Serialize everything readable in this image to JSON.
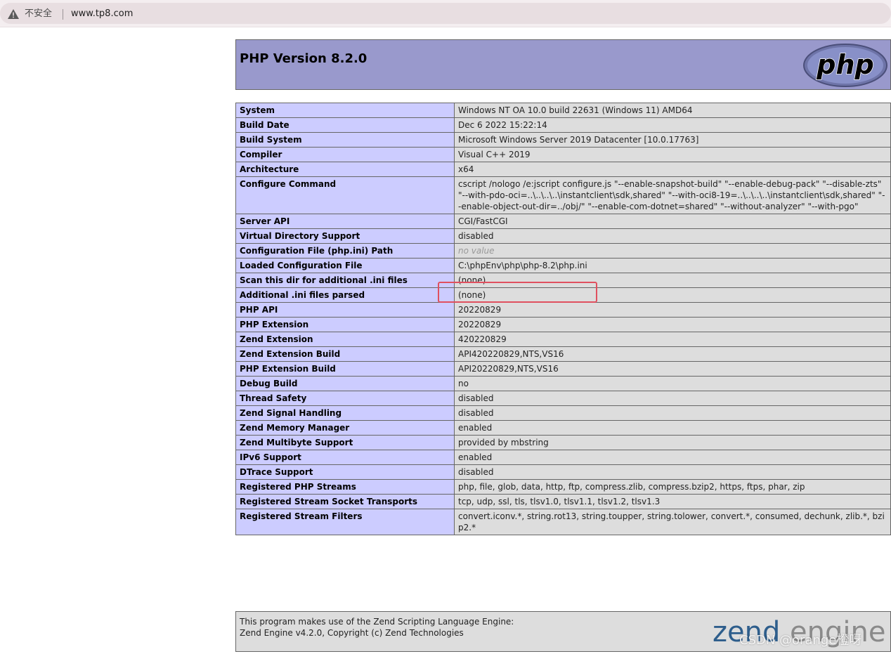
{
  "browser": {
    "security_label": "不安全",
    "url": "www.tp8.com"
  },
  "header": {
    "title": "PHP Version 8.2.0"
  },
  "rows": [
    {
      "key": "System",
      "value": "Windows NT OA 10.0 build 22631 (Windows 11) AMD64"
    },
    {
      "key": "Build Date",
      "value": "Dec 6 2022 15:22:14"
    },
    {
      "key": "Build System",
      "value": "Microsoft Windows Server 2019 Datacenter [10.0.17763]"
    },
    {
      "key": "Compiler",
      "value": "Visual C++ 2019"
    },
    {
      "key": "Architecture",
      "value": "x64"
    },
    {
      "key": "Configure Command",
      "value": "cscript /nologo /e:jscript configure.js \"--enable-snapshot-build\" \"--enable-debug-pack\" \"--disable-zts\" \"--with-pdo-oci=..\\..\\..\\..\\instantclient\\sdk,shared\" \"--with-oci8-19=..\\..\\..\\..\\instantclient\\sdk,shared\" \"--enable-object-out-dir=../obj/\" \"--enable-com-dotnet=shared\" \"--without-analyzer\" \"--with-pgo\""
    },
    {
      "key": "Server API",
      "value": "CGI/FastCGI"
    },
    {
      "key": "Virtual Directory Support",
      "value": "disabled"
    },
    {
      "key": "Configuration File (php.ini) Path",
      "value": "no value"
    },
    {
      "key": "Loaded Configuration File",
      "value": "C:\\phpEnv\\php\\php-8.2\\php.ini"
    },
    {
      "key": "Scan this dir for additional .ini files",
      "value": "(none)"
    },
    {
      "key": "Additional .ini files parsed",
      "value": "(none)"
    },
    {
      "key": "PHP API",
      "value": "20220829"
    },
    {
      "key": "PHP Extension",
      "value": "20220829"
    },
    {
      "key": "Zend Extension",
      "value": "420220829"
    },
    {
      "key": "Zend Extension Build",
      "value": "API420220829,NTS,VS16"
    },
    {
      "key": "PHP Extension Build",
      "value": "API20220829,NTS,VS16"
    },
    {
      "key": "Debug Build",
      "value": "no"
    },
    {
      "key": "Thread Safety",
      "value": "disabled"
    },
    {
      "key": "Zend Signal Handling",
      "value": "disabled"
    },
    {
      "key": "Zend Memory Manager",
      "value": "enabled"
    },
    {
      "key": "Zend Multibyte Support",
      "value": "provided by mbstring"
    },
    {
      "key": "IPv6 Support",
      "value": "enabled"
    },
    {
      "key": "DTrace Support",
      "value": "disabled"
    },
    {
      "key": "Registered PHP Streams",
      "value": "php, file, glob, data, http, ftp, compress.zlib, compress.bzip2, https, ftps, phar, zip"
    },
    {
      "key": "Registered Stream Socket Transports",
      "value": "tcp, udp, ssl, tls, tlsv1.0, tlsv1.1, tlsv1.2, tlsv1.3"
    },
    {
      "key": "Registered Stream Filters",
      "value": "convert.iconv.*, string.rot13, string.toupper, string.tolower, convert.*, consumed, dechunk, zlib.*, bzip2.*"
    }
  ],
  "footer": {
    "line1": "This program makes use of the Zend Scripting Language Engine:",
    "line2": "Zend Engine v4.2.0, Copyright (c) Zend Technologies",
    "logo_text_a": "zend",
    "logo_text_b": "engine",
    "watermark": "CSDN @orange橙呀"
  },
  "logos": {
    "php_logo_text": "php"
  },
  "colors": {
    "header_bg": "#9999cc",
    "key_bg": "#ccccff",
    "value_bg": "#dddddd",
    "highlight": "#e0505f"
  }
}
